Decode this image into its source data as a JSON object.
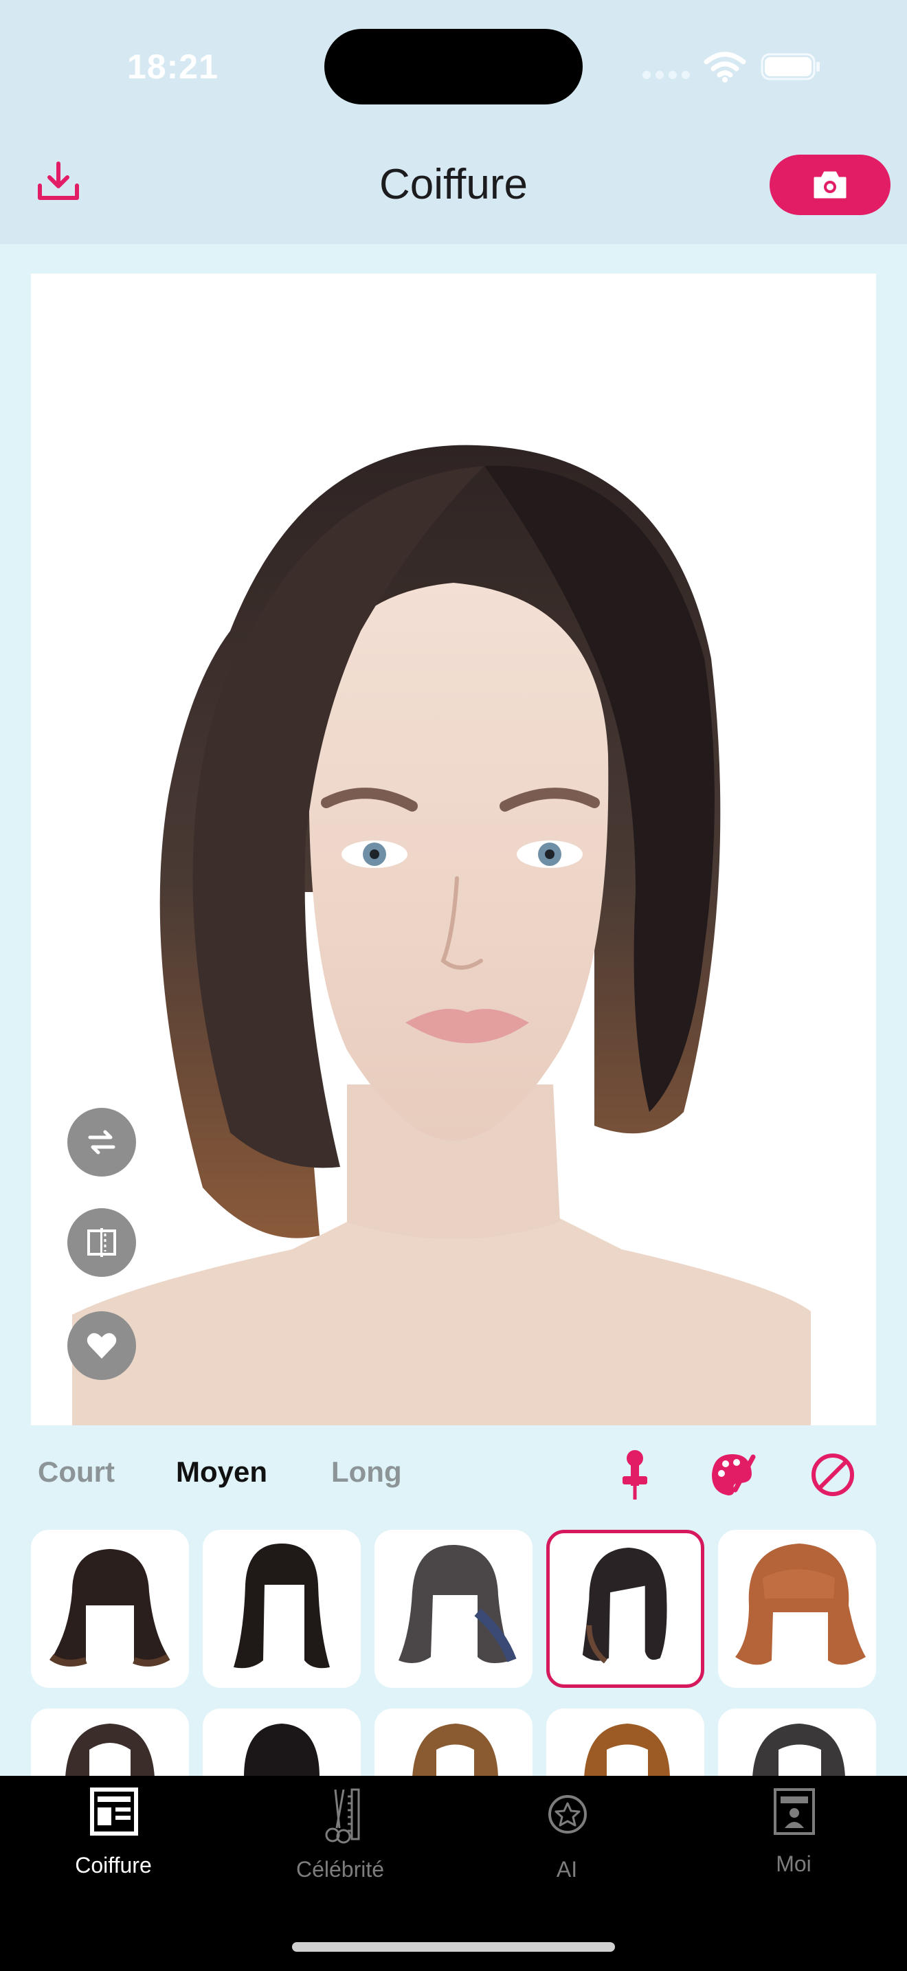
{
  "status_bar": {
    "time": "18:21"
  },
  "header": {
    "title": "Coiffure",
    "download_icon": "download-icon",
    "camera_icon": "camera-icon"
  },
  "colors": {
    "accent": "#e21d66",
    "background": "#dff3f8",
    "header": "#d6e9f3",
    "tabbar": "#000000"
  },
  "photo": {
    "tools": [
      {
        "name": "swap-icon"
      },
      {
        "name": "compare-icon"
      },
      {
        "name": "heart-icon"
      }
    ]
  },
  "categories": {
    "items": [
      {
        "label": "Court",
        "active": false
      },
      {
        "label": "Moyen",
        "active": true
      },
      {
        "label": "Long",
        "active": false
      }
    ],
    "tools": [
      "pin-icon",
      "palette-icon",
      "none-icon"
    ]
  },
  "hairstyles": {
    "selected_index": 3,
    "row1": [
      "dark-brown-bob",
      "black-long-bob",
      "ash-layered-bob",
      "side-part-bob",
      "auburn-bangs-bob"
    ],
    "row2": [
      "dark-brown",
      "black",
      "golden-brown",
      "copper-brown",
      "dark-gray"
    ]
  },
  "tabbar": {
    "tabs": [
      {
        "label": "Coiffure",
        "icon": "layout-icon",
        "active": true
      },
      {
        "label": "Célébrité",
        "icon": "scissors-comb-icon",
        "active": false
      },
      {
        "label": "AI",
        "icon": "star-badge-icon",
        "active": false
      },
      {
        "label": "Moi",
        "icon": "profile-card-icon",
        "active": false
      }
    ]
  }
}
